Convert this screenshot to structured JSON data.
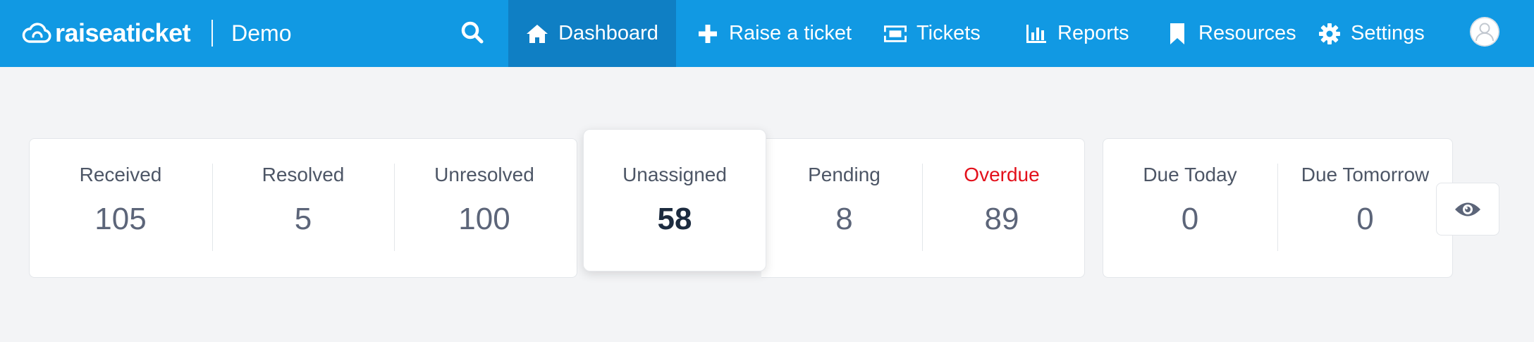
{
  "brand": {
    "name": "raiseaticket",
    "workspace": "Demo"
  },
  "nav": {
    "dashboard": "Dashboard",
    "raise": "Raise a ticket",
    "tickets": "Tickets",
    "reports": "Reports",
    "resources": "Resources",
    "settings": "Settings"
  },
  "colors": {
    "navbar": "#1199e3",
    "active_nav": "#0f7fc4",
    "overdue": "#e3101b",
    "background": "#f3f4f6"
  },
  "icons": [
    "cloud-logo-icon",
    "search-icon",
    "home-icon",
    "plus-icon",
    "ticket-icon",
    "bar-chart-icon",
    "bookmark-icon",
    "gear-icon",
    "user-avatar-icon",
    "eye-icon"
  ],
  "stats": {
    "received": {
      "label": "Received",
      "value": "105"
    },
    "resolved": {
      "label": "Resolved",
      "value": "5"
    },
    "unresolved": {
      "label": "Unresolved",
      "value": "100"
    },
    "unassigned": {
      "label": "Unassigned",
      "value": "58"
    },
    "pending": {
      "label": "Pending",
      "value": "8"
    },
    "overdue": {
      "label": "Overdue",
      "value": "89"
    },
    "due_today": {
      "label": "Due Today",
      "value": "0"
    },
    "due_tomorrow": {
      "label": "Due Tomorrow",
      "value": "0"
    }
  }
}
